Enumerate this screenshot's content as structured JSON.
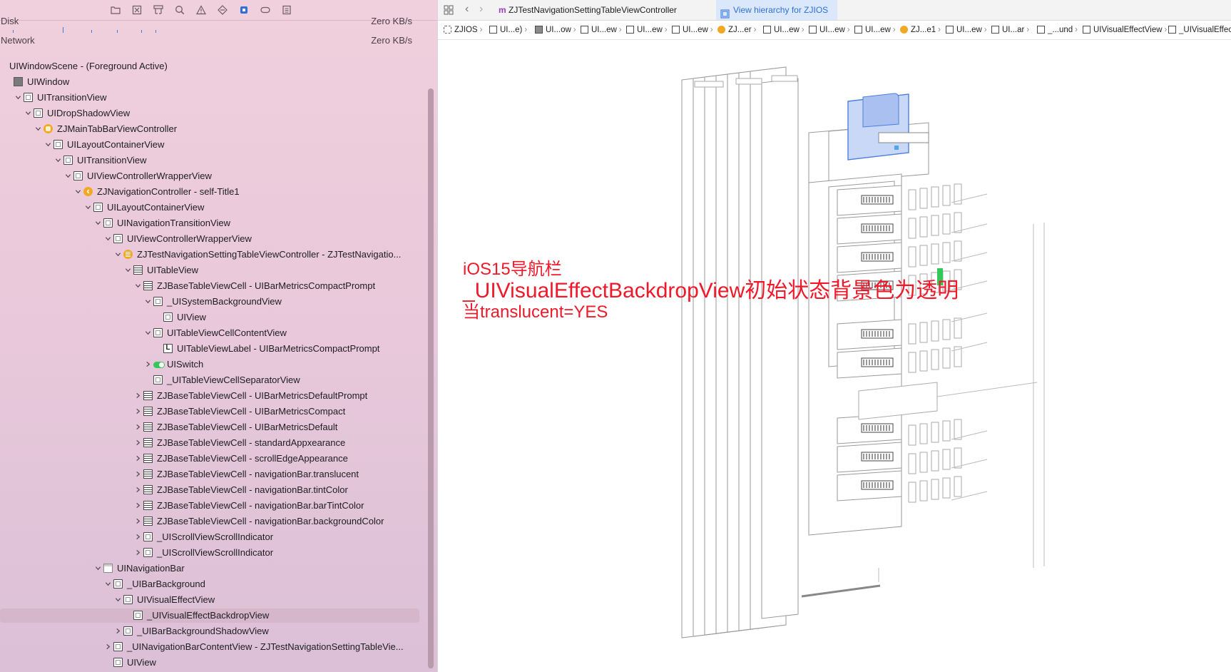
{
  "navigator": {
    "toolbar_icons": [
      "folder-icon",
      "x-square-icon",
      "hierarchy-icon",
      "search-icon",
      "warning-icon",
      "diamond-icon",
      "debug-icon",
      "tag-icon",
      "list-icon"
    ],
    "metrics": [
      {
        "label": "Disk",
        "value": "Zero KB/s"
      },
      {
        "label": "Network",
        "value": "Zero KB/s"
      }
    ],
    "tree": [
      {
        "depth": 0,
        "chevron": "none",
        "icon": "none",
        "label": "UIWindowScene - (Foreground Active)"
      },
      {
        "depth": 0,
        "chevron": "none",
        "icon": "window",
        "label": "UIWindow"
      },
      {
        "depth": 1,
        "chevron": "down",
        "icon": "view",
        "label": "UITransitionView"
      },
      {
        "depth": 2,
        "chevron": "down",
        "icon": "view",
        "label": "UIDropShadowView"
      },
      {
        "depth": 3,
        "chevron": "down",
        "icon": "controller",
        "label": "ZJMainTabBarViewController"
      },
      {
        "depth": 4,
        "chevron": "down",
        "icon": "view",
        "label": "UILayoutContainerView"
      },
      {
        "depth": 5,
        "chevron": "down",
        "icon": "view",
        "label": "UITransitionView"
      },
      {
        "depth": 6,
        "chevron": "down",
        "icon": "view",
        "label": "UIViewControllerWrapperView"
      },
      {
        "depth": 7,
        "chevron": "down",
        "icon": "nav",
        "label": "ZJNavigationController - self-Title1"
      },
      {
        "depth": 8,
        "chevron": "down",
        "icon": "view",
        "label": "UILayoutContainerView"
      },
      {
        "depth": 9,
        "chevron": "down",
        "icon": "view",
        "label": "UINavigationTransitionView"
      },
      {
        "depth": 10,
        "chevron": "down",
        "icon": "view",
        "label": "UIViewControllerWrapperView"
      },
      {
        "depth": 11,
        "chevron": "down",
        "icon": "tvc",
        "label": "ZJTestNavigationSettingTableViewController - ZJTestNavigatio..."
      },
      {
        "depth": 12,
        "chevron": "down",
        "icon": "table",
        "label": "UITableView"
      },
      {
        "depth": 13,
        "chevron": "down",
        "icon": "table",
        "label": "ZJBaseTableViewCell - UIBarMetricsCompactPrompt"
      },
      {
        "depth": 14,
        "chevron": "down",
        "icon": "view",
        "label": "_UISystemBackgroundView"
      },
      {
        "depth": 15,
        "chevron": "none",
        "icon": "view",
        "label": "UIView"
      },
      {
        "depth": 14,
        "chevron": "down",
        "icon": "view",
        "label": "UITableViewCellContentView"
      },
      {
        "depth": 15,
        "chevron": "none",
        "icon": "label",
        "label": "UITableViewLabel - UIBarMetricsCompactPrompt"
      },
      {
        "depth": 14,
        "chevron": "right",
        "icon": "switch",
        "label": "UISwitch"
      },
      {
        "depth": 14,
        "chevron": "none",
        "icon": "view",
        "label": "_UITableViewCellSeparatorView"
      },
      {
        "depth": 13,
        "chevron": "right",
        "icon": "table",
        "label": "ZJBaseTableViewCell - UIBarMetricsDefaultPrompt"
      },
      {
        "depth": 13,
        "chevron": "right",
        "icon": "table",
        "label": "ZJBaseTableViewCell - UIBarMetricsCompact"
      },
      {
        "depth": 13,
        "chevron": "right",
        "icon": "table",
        "label": "ZJBaseTableViewCell - UIBarMetricsDefault"
      },
      {
        "depth": 13,
        "chevron": "right",
        "icon": "table",
        "label": "ZJBaseTableViewCell - standardAppxearance"
      },
      {
        "depth": 13,
        "chevron": "right",
        "icon": "table",
        "label": "ZJBaseTableViewCell - scrollEdgeAppearance"
      },
      {
        "depth": 13,
        "chevron": "right",
        "icon": "table",
        "label": "ZJBaseTableViewCell - navigationBar.translucent"
      },
      {
        "depth": 13,
        "chevron": "right",
        "icon": "table",
        "label": "ZJBaseTableViewCell - navigationBar.tintColor"
      },
      {
        "depth": 13,
        "chevron": "right",
        "icon": "table",
        "label": "ZJBaseTableViewCell - navigationBar.barTintColor"
      },
      {
        "depth": 13,
        "chevron": "right",
        "icon": "table",
        "label": "ZJBaseTableViewCell - navigationBar.backgroundColor"
      },
      {
        "depth": 13,
        "chevron": "right",
        "icon": "view",
        "label": "_UIScrollViewScrollIndicator"
      },
      {
        "depth": 13,
        "chevron": "right",
        "icon": "view",
        "label": "_UIScrollViewScrollIndicator"
      },
      {
        "depth": 9,
        "chevron": "down",
        "icon": "navbar",
        "label": "UINavigationBar"
      },
      {
        "depth": 10,
        "chevron": "down",
        "icon": "view",
        "label": "_UIBarBackground"
      },
      {
        "depth": 11,
        "chevron": "down",
        "icon": "view",
        "label": "UIVisualEffectView"
      },
      {
        "depth": 12,
        "chevron": "none",
        "icon": "view",
        "label": "_UIVisualEffectBackdropView",
        "selected": true
      },
      {
        "depth": 11,
        "chevron": "right",
        "icon": "view",
        "label": "_UIBarBackgroundShadowView"
      },
      {
        "depth": 10,
        "chevron": "right",
        "icon": "view",
        "label": "_UINavigationBarContentView - ZJTestNavigationSettingTableVie..."
      },
      {
        "depth": 10,
        "chevron": "none",
        "icon": "view",
        "label": "UIView"
      }
    ]
  },
  "editor": {
    "tabs": [
      {
        "icon": "m",
        "label": "ZJTestNavigationSettingTableViewController",
        "active": false
      },
      {
        "icon": "hierarchy",
        "label": "View hierarchy for ZJIOS",
        "active": true
      }
    ],
    "jump_bar": [
      {
        "icon": "target",
        "label": "ZJIOS"
      },
      {
        "icon": "view",
        "label": "UI...e)"
      },
      {
        "icon": "gray",
        "label": "UI...ow"
      },
      {
        "icon": "view",
        "label": "UI...ew"
      },
      {
        "icon": "view",
        "label": "UI...ew"
      },
      {
        "icon": "view",
        "label": "UI...ew"
      },
      {
        "icon": "orange",
        "label": "ZJ...er"
      },
      {
        "icon": "view",
        "label": "UI...ew"
      },
      {
        "icon": "view",
        "label": "UI...ew"
      },
      {
        "icon": "view",
        "label": "UI...ew"
      },
      {
        "icon": "orange",
        "label": "ZJ...e1"
      },
      {
        "icon": "view",
        "label": "UI...ew"
      },
      {
        "icon": "view",
        "label": "UI...ar"
      },
      {
        "icon": "view",
        "label": "_...und"
      },
      {
        "icon": "view",
        "label": "UIVisualEffectView"
      },
      {
        "icon": "view",
        "label": "_UIVisualEffectBack"
      }
    ],
    "annotation": {
      "line1": "iOS15导航栏",
      "line2": "_UIVisualEffectBackdropView初始状态背景色为透明",
      "line3": "当translucent=YES"
    },
    "colors": {
      "annotation": "#f0192a",
      "selection": "#4a7fe0",
      "switch": "#34c759"
    }
  }
}
